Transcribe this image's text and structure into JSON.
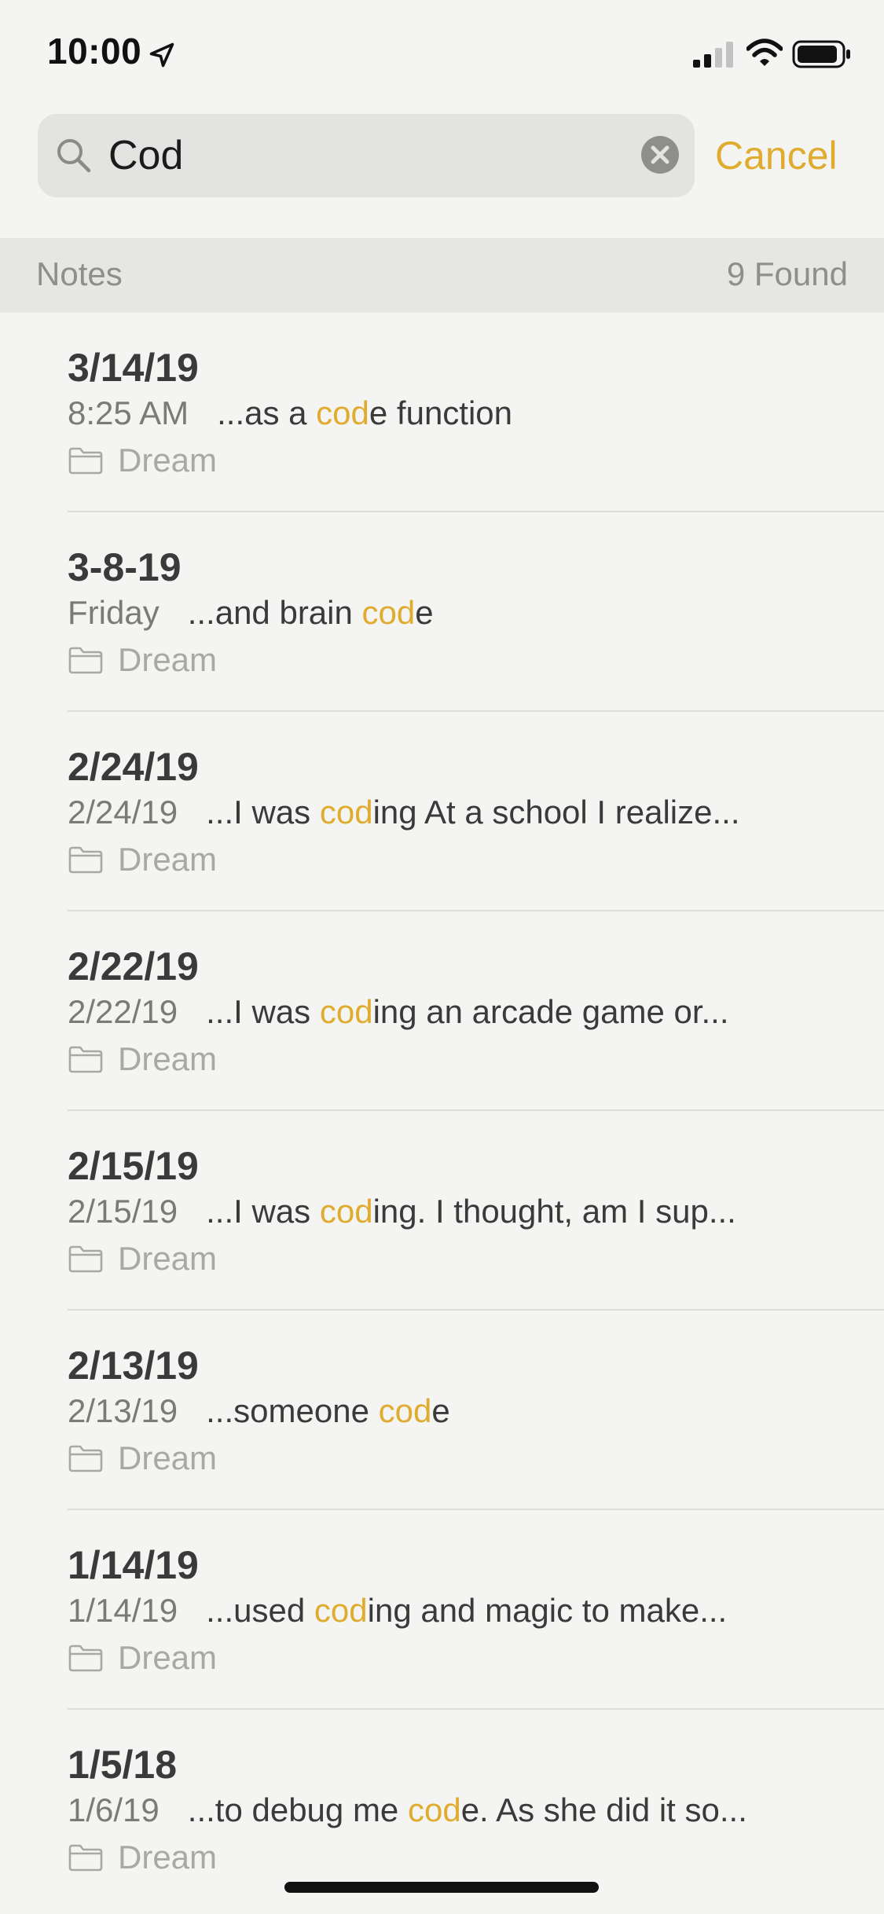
{
  "status_bar": {
    "time": "10:00"
  },
  "search": {
    "query": "Cod",
    "cancel_label": "Cancel"
  },
  "section": {
    "title": "Notes",
    "count": "9 Found"
  },
  "colors": {
    "accent": "#e0ac2f",
    "background": "#f4f4f2"
  },
  "notes": [
    {
      "title": "3/14/19",
      "date": "8:25 AM",
      "pre": "...as a ",
      "hl": "cod",
      "post": "e function",
      "folder": "Dream"
    },
    {
      "title": "3-8-19",
      "date": "Friday",
      "pre": "...and brain ",
      "hl": "cod",
      "post": "e",
      "folder": "Dream"
    },
    {
      "title": "2/24/19",
      "date": "2/24/19",
      "pre": "...I was ",
      "hl": "cod",
      "post": "ing At a school I realize...",
      "folder": "Dream"
    },
    {
      "title": "2/22/19",
      "date": "2/22/19",
      "pre": "...I was ",
      "hl": "cod",
      "post": "ing an arcade game or...",
      "folder": "Dream"
    },
    {
      "title": "2/15/19",
      "date": "2/15/19",
      "pre": "...I was ",
      "hl": "cod",
      "post": "ing. I thought, am I sup...",
      "folder": "Dream"
    },
    {
      "title": "2/13/19",
      "date": "2/13/19",
      "pre": "...someone ",
      "hl": "cod",
      "post": "e",
      "folder": "Dream"
    },
    {
      "title": "1/14/19",
      "date": "1/14/19",
      "pre": "...used ",
      "hl": "cod",
      "post": "ing and magic to make...",
      "folder": "Dream"
    },
    {
      "title": "1/5/18",
      "date": "1/6/19",
      "pre": "...to debug me ",
      "hl": "cod",
      "post": "e. As she did it so...",
      "folder": "Dream"
    }
  ]
}
